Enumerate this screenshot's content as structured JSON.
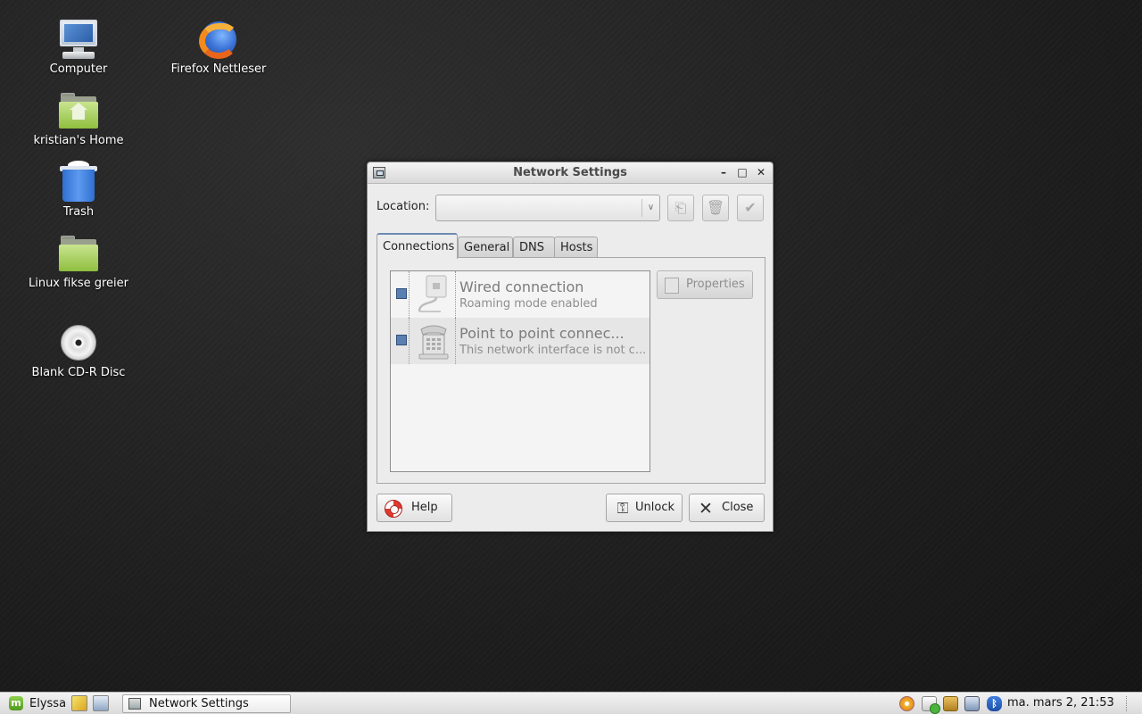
{
  "desktop": {
    "icons": [
      {
        "label": "Computer",
        "icon": "computer-icon"
      },
      {
        "label": "Firefox Nettleser",
        "icon": "firefox-icon"
      },
      {
        "label": "kristian's Home",
        "icon": "home-folder-icon"
      },
      {
        "label": "Trash",
        "icon": "trash-icon"
      },
      {
        "label": "Linux fikse greier",
        "icon": "folder-icon"
      },
      {
        "label": "Blank CD-R Disc",
        "icon": "cd-disc-icon"
      }
    ]
  },
  "window": {
    "title": "Network Settings",
    "location_label": "Location:",
    "location_value": "",
    "tabs": [
      {
        "label": "Connections",
        "active": true
      },
      {
        "label": "General",
        "active": false
      },
      {
        "label": "DNS",
        "active": false
      },
      {
        "label": "Hosts",
        "active": false
      }
    ],
    "connections": [
      {
        "name": "Wired connection",
        "status": "Roaming mode enabled",
        "checked": true,
        "icon": "wired-network-icon"
      },
      {
        "name": "Point to point connec...",
        "status": "This network interface is not c...",
        "checked": true,
        "icon": "telephone-modem-icon"
      }
    ],
    "properties_label": "Properties",
    "buttons": {
      "help": "Help",
      "unlock": "Unlock",
      "close": "Close"
    }
  },
  "taskbar": {
    "menu_label": "Elyssa",
    "task_label": "Network Settings",
    "clock": "ma. mars  2, 21:53"
  },
  "colors": {
    "desktop_bg": "#1e1e1e",
    "tab_accent": "#6d8bb3",
    "check_fill": "#5a7fb0"
  }
}
